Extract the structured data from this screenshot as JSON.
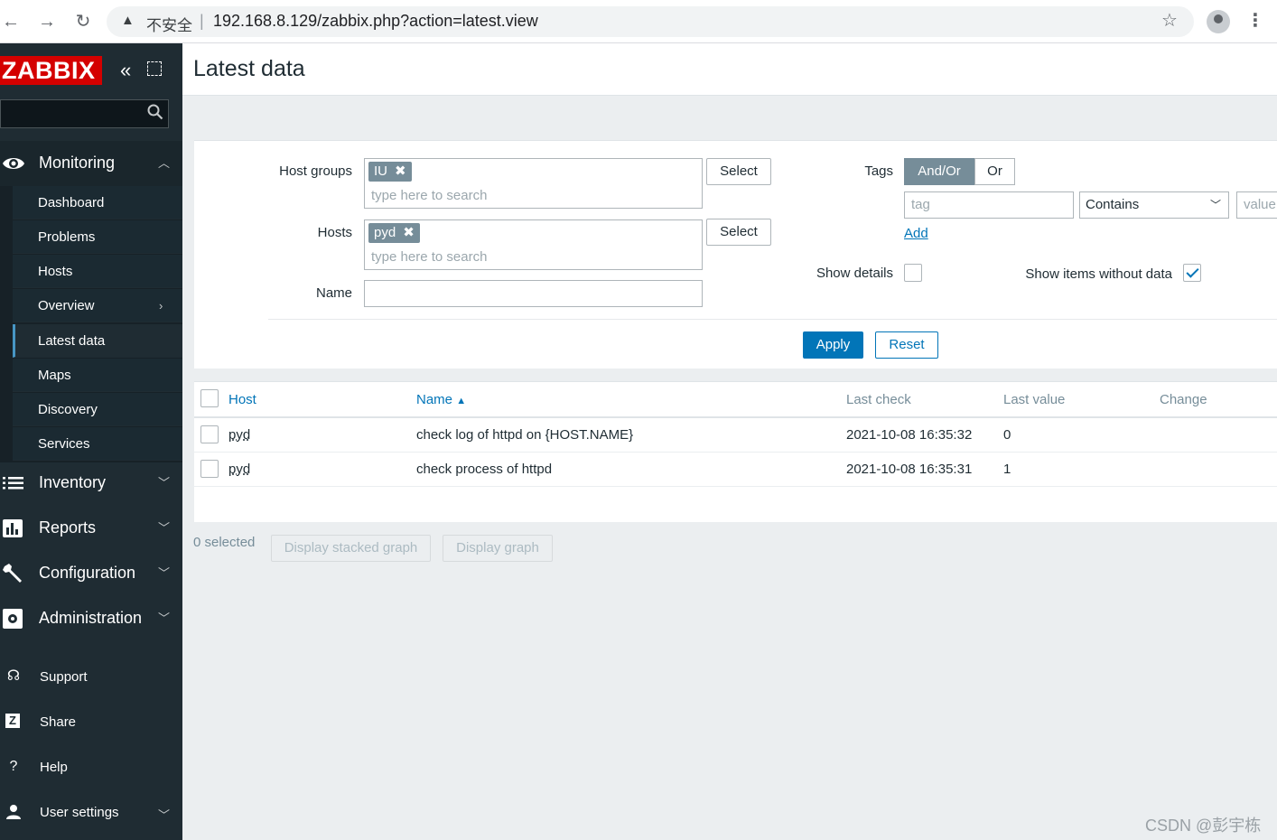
{
  "browser": {
    "insecure_label": "不安全",
    "separator": "|",
    "url": "192.168.8.129/zabbix.php?action=latest.view"
  },
  "sidebar": {
    "logo": "ZABBIX",
    "sections": {
      "monitoring": "Monitoring",
      "inventory": "Inventory",
      "reports": "Reports",
      "configuration": "Configuration",
      "administration": "Administration"
    },
    "monitoring_items": [
      "Dashboard",
      "Problems",
      "Hosts",
      "Overview",
      "Latest data",
      "Maps",
      "Discovery",
      "Services"
    ],
    "active_item": "Latest data",
    "bottom": {
      "support": "Support",
      "share": "Share",
      "help": "Help",
      "user_settings": "User settings"
    }
  },
  "header": {
    "title": "Latest data"
  },
  "filter": {
    "host_groups_label": "Host groups",
    "host_groups_chip": "IU",
    "hosts_label": "Hosts",
    "hosts_chip": "pyd",
    "search_placeholder": "type here to search",
    "name_label": "Name",
    "name_value": "",
    "select_label": "Select",
    "tags_label": "Tags",
    "tags_andor": "And/Or",
    "tags_or": "Or",
    "tag_placeholder": "tag",
    "tag_operator": "Contains",
    "value_placeholder": "value",
    "add_link": "Add",
    "show_details_label": "Show details",
    "show_details_checked": false,
    "show_without_data_label": "Show items without data",
    "show_without_data_checked": true,
    "apply_label": "Apply",
    "reset_label": "Reset"
  },
  "table": {
    "columns": [
      "Host",
      "Name",
      "Last check",
      "Last value",
      "Change"
    ],
    "sort_arrow": "▲",
    "rows": [
      {
        "host": "pyd",
        "name": "check log of httpd on {HOST.NAME}",
        "last_check": "2021-10-08 16:35:32",
        "last_value": "0",
        "change": ""
      },
      {
        "host": "pyd",
        "name": "check process of httpd",
        "last_check": "2021-10-08 16:35:31",
        "last_value": "1",
        "change": ""
      }
    ]
  },
  "footer": {
    "selected": "0 selected",
    "stacked_graph": "Display stacked graph",
    "graph": "Display graph"
  },
  "watermark": "CSDN @彭宇栋",
  "colors": {
    "accent": "#0275b8",
    "sidebar": "#1f2c33",
    "logo": "#d40000"
  }
}
